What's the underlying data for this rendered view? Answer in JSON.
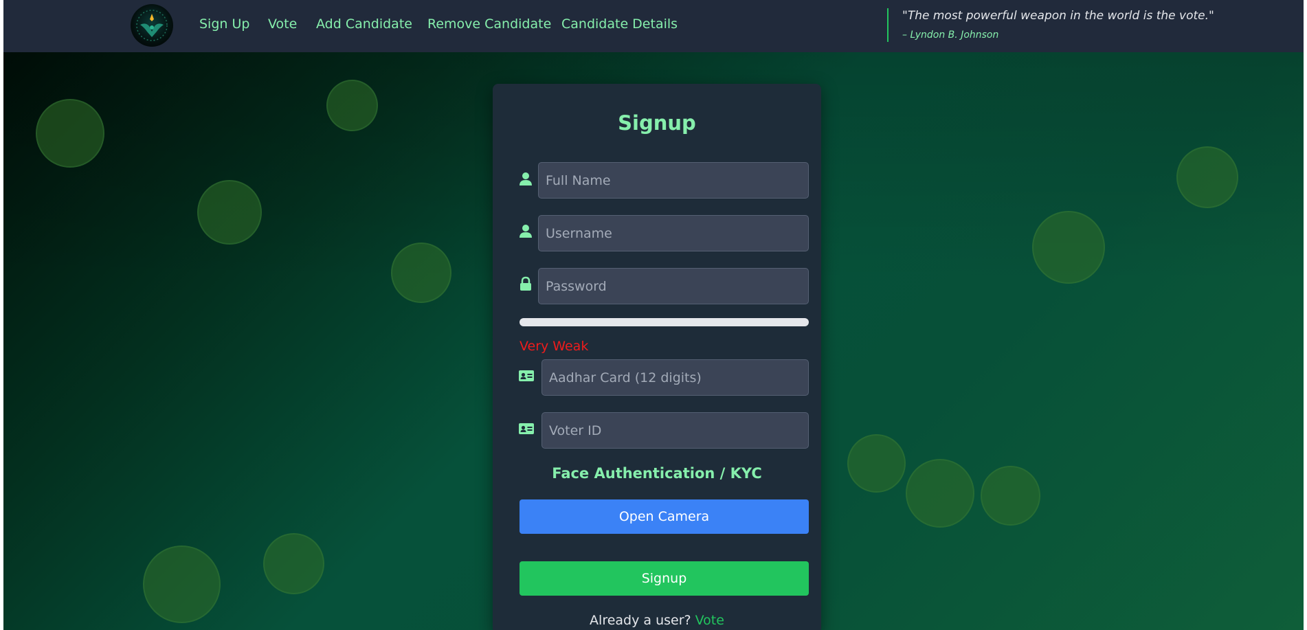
{
  "navbar": {
    "links": [
      "Sign Up",
      "Vote",
      "Add Candidate",
      "Remove Candidate",
      "Candidate Details"
    ],
    "quote": "\"The most powerful weapon in the world is the vote.\"",
    "quote_author": "– Lyndon B. Johnson",
    "logo_icon": "eagle-emblem-icon"
  },
  "form": {
    "title": "Signup",
    "fields": [
      {
        "icon": "user-icon",
        "placeholder": "Full Name",
        "value": ""
      },
      {
        "icon": "user-icon",
        "placeholder": "Username",
        "value": ""
      },
      {
        "icon": "lock-icon",
        "placeholder": "Password",
        "value": ""
      },
      {
        "icon": "id-card-icon",
        "placeholder": "Aadhar Card (12 digits)",
        "value": ""
      },
      {
        "icon": "id-card-icon",
        "placeholder": "Voter ID",
        "value": ""
      }
    ],
    "password_strength": {
      "label": "Very Weak",
      "level": 0
    },
    "kyc_title": "Face Authentication / KYC",
    "open_camera_label": "Open Camera",
    "submit_label": "Signup",
    "already_user_text": "Already a user?",
    "vote_link_label": "Vote"
  },
  "colors": {
    "accent_green": "#86efac",
    "button_blue": "#3b82f6",
    "button_green": "#22c55e",
    "weak_red": "#ef1c1c",
    "navbar_bg": "#212a3b",
    "card_bg": "#1e2c39"
  }
}
